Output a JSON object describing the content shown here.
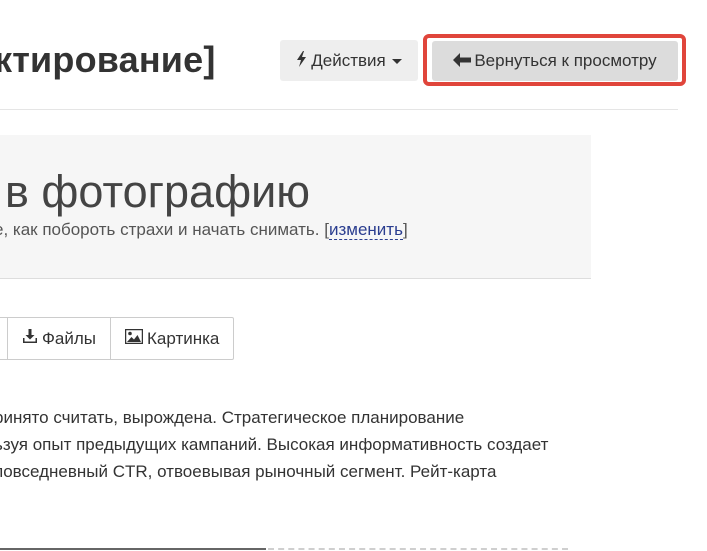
{
  "header": {
    "title": "ктирование]",
    "actions_label": "Действия",
    "back_label": "Вернуться к просмотру"
  },
  "hero": {
    "title": "в фотографию",
    "subtitle": "е, как побороть страхи и начать снимать.",
    "edit_bracket_open": "[",
    "edit_link": "изменить",
    "edit_bracket_close": "]"
  },
  "toolbar": {
    "files_label": "Файлы",
    "image_label": "Картинка"
  },
  "body": {
    "lines": [
      "ринято считать, вырождена. Стратегическое планирование",
      "ьзуя опыт предыдущих кампаний. Высокая информативность создает",
      "повседневный CTR, отвоевывая рыночный сегмент. Рейт-карта"
    ]
  },
  "icons": {
    "actions": "bolt-icon",
    "back": "arrow-left-icon",
    "files": "download-icon",
    "image": "image-icon"
  },
  "colors": {
    "highlight": "#e0453b",
    "link": "#2a3d8f",
    "hero_bg": "#f6f6f6"
  }
}
